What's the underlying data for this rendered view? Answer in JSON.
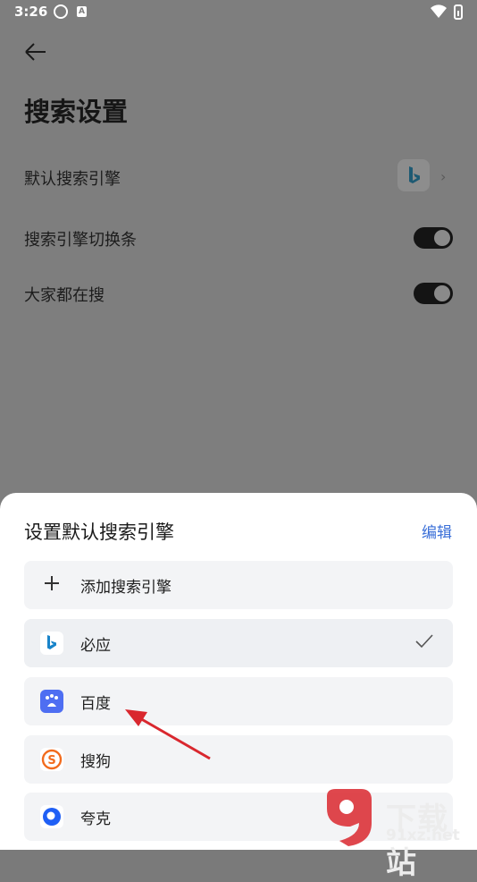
{
  "status_bar": {
    "time": "3:26",
    "icon_b_letter": "A"
  },
  "page": {
    "title": "搜索设置"
  },
  "settings": [
    {
      "label": "默认搜索引擎"
    },
    {
      "label": "搜索引擎切换条",
      "enabled": true
    },
    {
      "label": "大家都在搜",
      "enabled": true
    }
  ],
  "sheet": {
    "title": "设置默认搜索引擎",
    "edit_label": "编辑",
    "add_label": "添加搜索引擎",
    "engines": [
      {
        "label": "必应",
        "icon": "bing-icon",
        "selected": true
      },
      {
        "label": "百度",
        "icon": "baidu-icon",
        "selected": false
      },
      {
        "label": "搜狗",
        "icon": "sogou-icon",
        "selected": false
      },
      {
        "label": "夸克",
        "icon": "quark-icon",
        "selected": false
      }
    ]
  },
  "watermark": {
    "big": "下载站",
    "small": "91xz.net"
  },
  "colors": {
    "accent": "#3a6fd8",
    "dim_overlay": "#7e7e7e",
    "annotation_arrow": "#d9272e"
  }
}
